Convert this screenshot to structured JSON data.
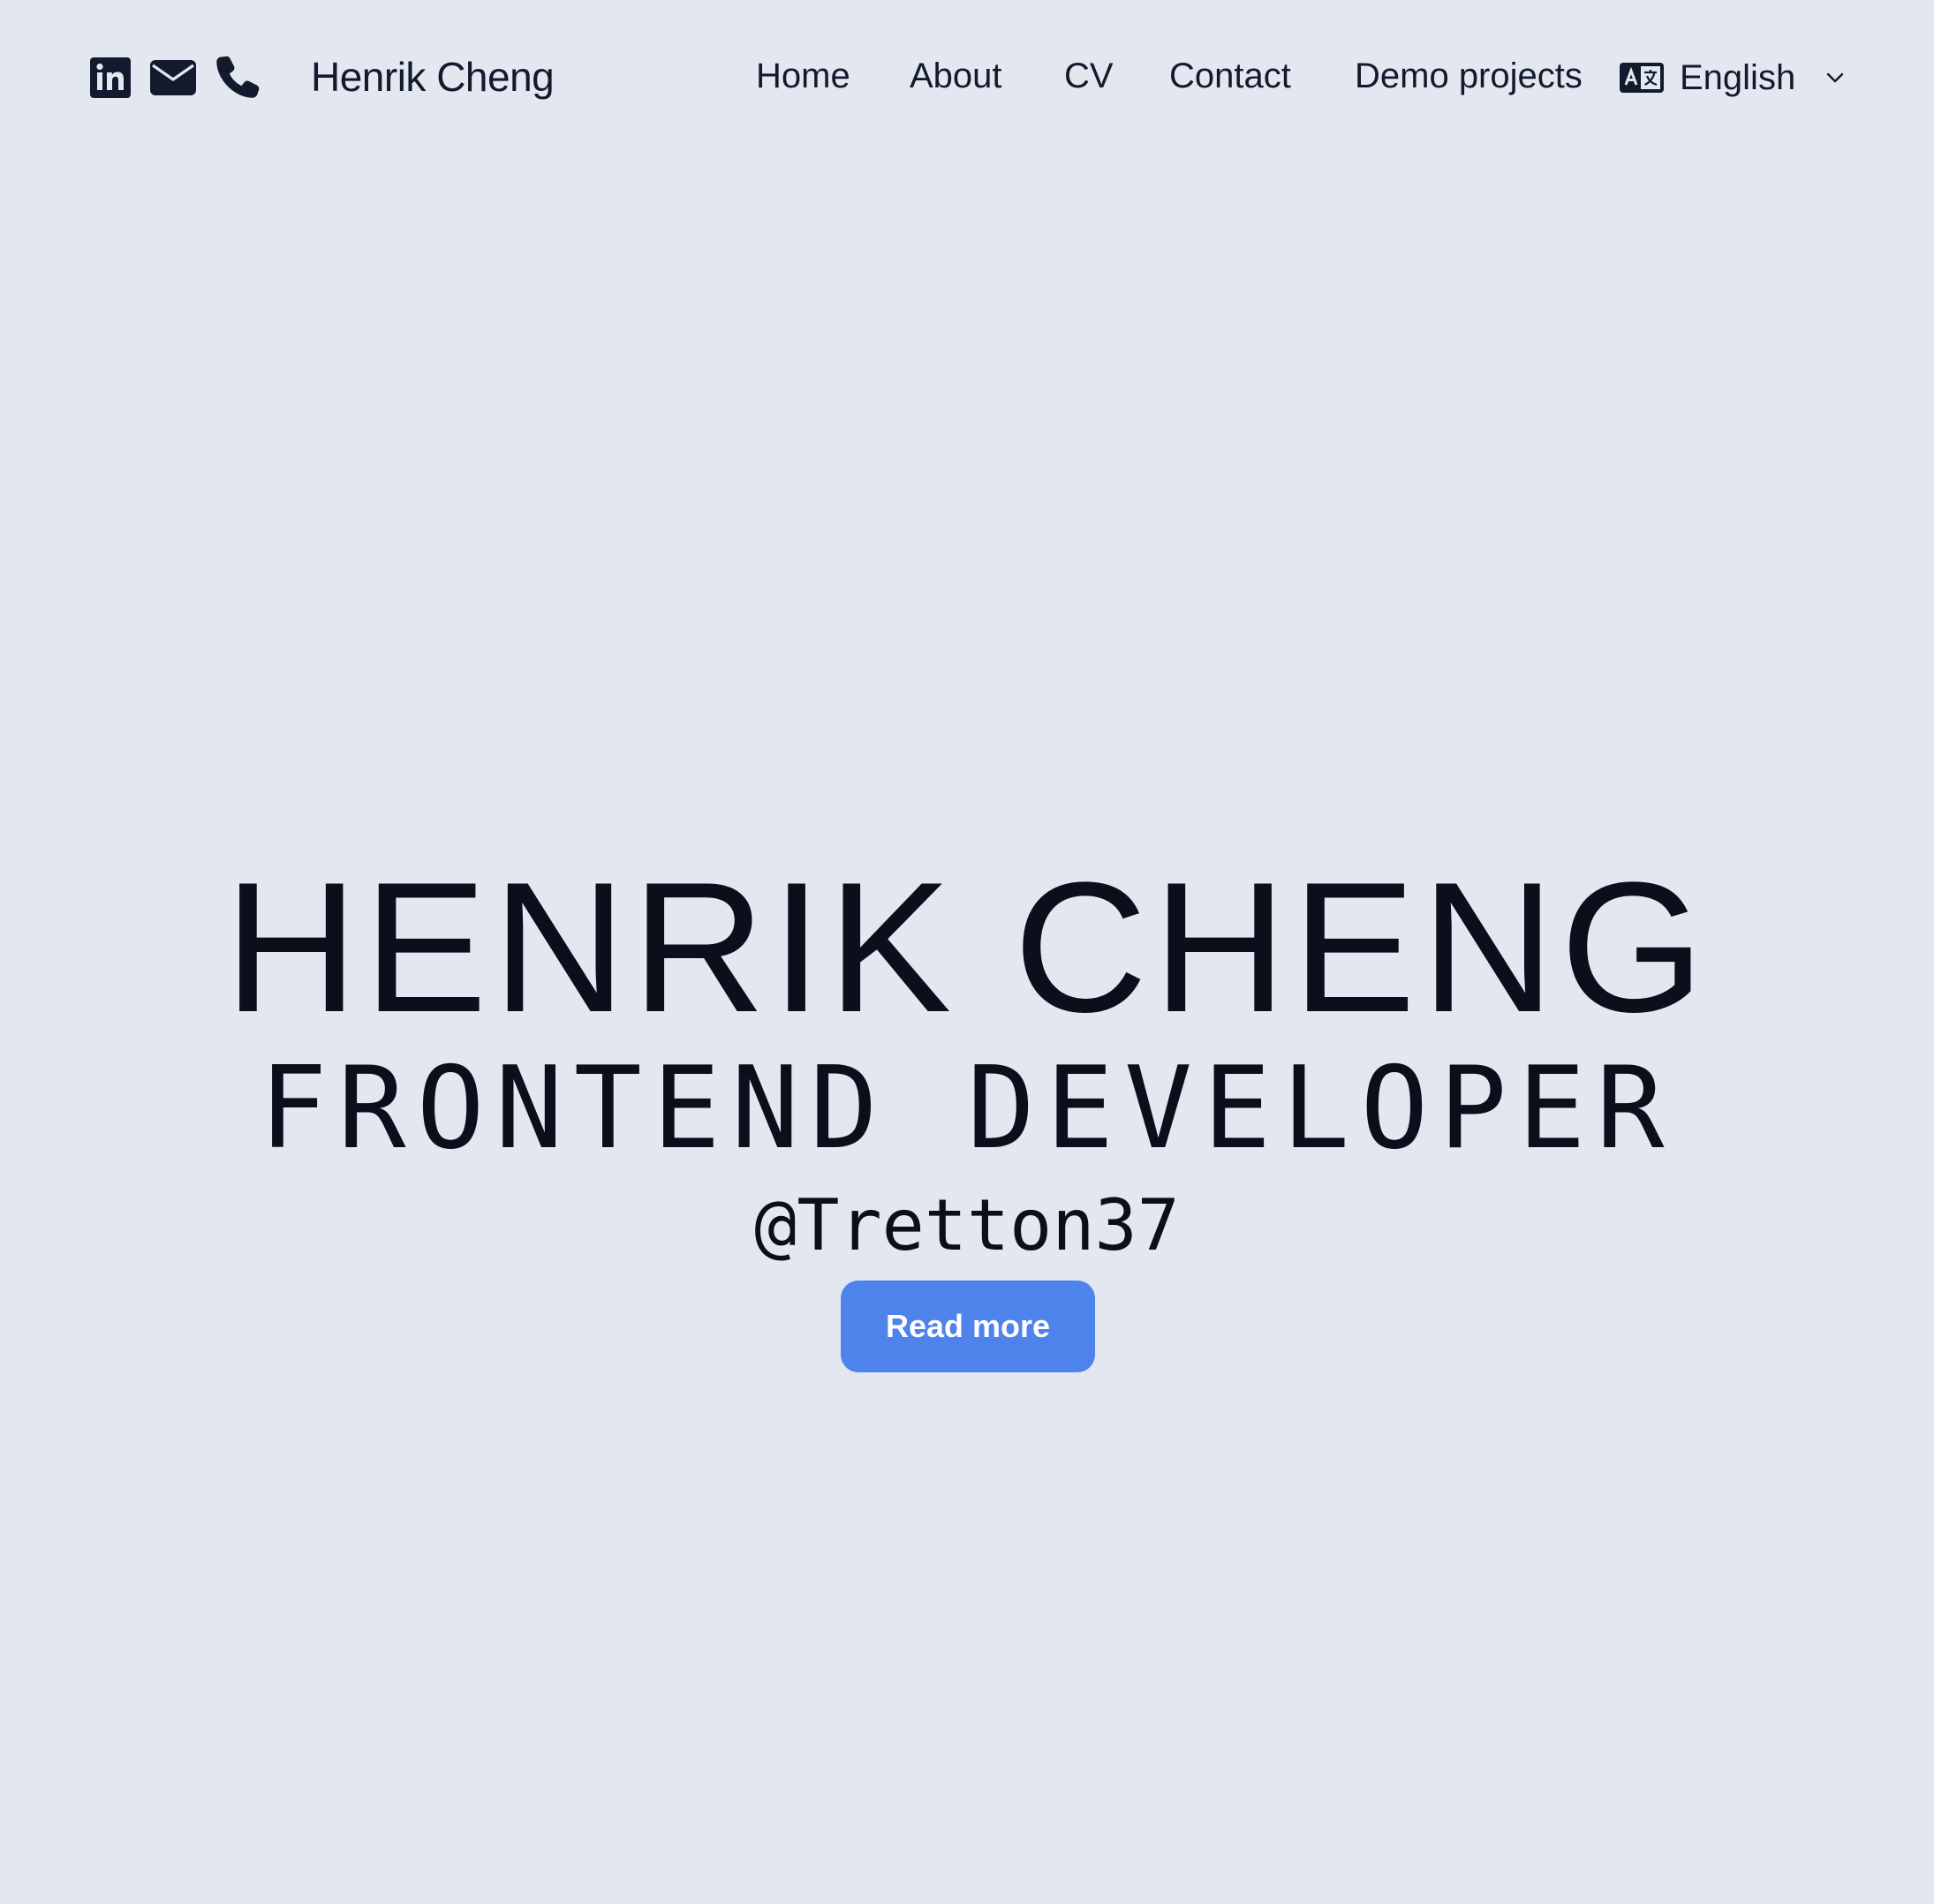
{
  "colors": {
    "background": "#e3e8f0",
    "text": "#131a2e",
    "accent": "#4f83ec",
    "button_text": "#ffffff"
  },
  "header": {
    "social_icons": [
      "linkedin-icon",
      "mail-icon",
      "phone-icon"
    ],
    "brand": "Henrik Cheng",
    "nav": {
      "home": "Home",
      "about": "About",
      "cv": "CV",
      "contact": "Contact",
      "demo_projects": "Demo projects"
    },
    "language": {
      "icon": "translate-icon",
      "selected": "English",
      "chevron": "chevron-down-icon"
    }
  },
  "hero": {
    "name": "HENRIK CHENG",
    "role": "FRONTEND DEVELOPER",
    "handle": "@Tretton37",
    "cta": "Read more"
  }
}
